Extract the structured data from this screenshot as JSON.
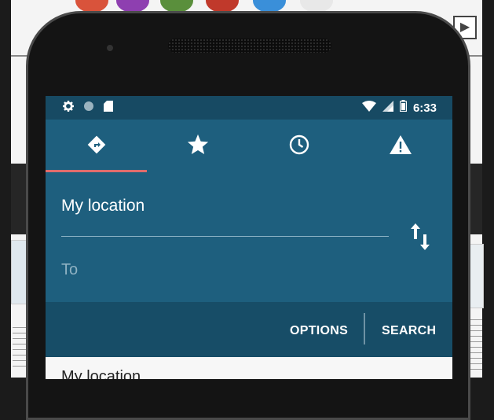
{
  "background": {
    "dot_colors": [
      "#d9533b",
      "#8e3fb0",
      "#5a8f3c",
      "#c0392b",
      "#3a8fd9",
      "#e8e8e8"
    ],
    "play_icon": "play-icon"
  },
  "status_bar": {
    "left_icons": [
      "settings-icon",
      "circle-icon",
      "sd-card-icon"
    ],
    "right_icons": [
      "wifi-icon",
      "cell-signal-icon",
      "battery-icon"
    ],
    "time": "6:33"
  },
  "tabs": [
    {
      "icon": "directions-icon",
      "selected": true
    },
    {
      "icon": "star-icon",
      "selected": false
    },
    {
      "icon": "history-icon",
      "selected": false
    },
    {
      "icon": "warning-icon",
      "selected": false
    }
  ],
  "route": {
    "from": "My location",
    "to_placeholder": "To",
    "swap_icon": "swap-vertical-icon"
  },
  "actions": {
    "options": "OPTIONS",
    "search": "SEARCH"
  },
  "list": {
    "first_item": "My location"
  },
  "colors": {
    "primary": "#1e5f7e",
    "primary_dark": "#174a63",
    "indicator": "#e06c6c"
  }
}
